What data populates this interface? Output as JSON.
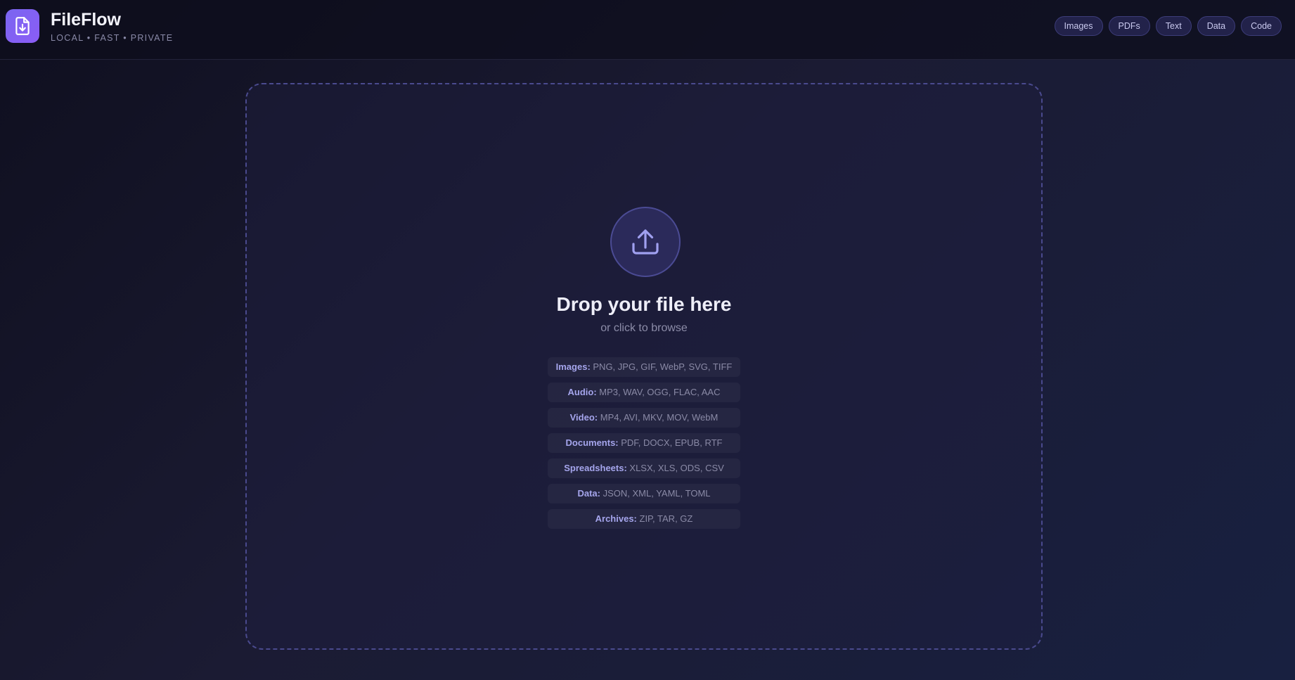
{
  "header": {
    "logo_icon": "file-download-icon",
    "title": "FileFlow",
    "tagline": "LOCAL • FAST • PRIVATE",
    "nav": [
      {
        "label": "Images"
      },
      {
        "label": "PDFs"
      },
      {
        "label": "Text"
      },
      {
        "label": "Data"
      },
      {
        "label": "Code"
      }
    ]
  },
  "dropzone": {
    "icon": "upload-icon",
    "title": "Drop your file here",
    "subtitle": "or click to browse",
    "formats": [
      {
        "label": "Images:",
        "values": "PNG, JPG, GIF, WebP, SVG, TIFF"
      },
      {
        "label": "Audio:",
        "values": "MP3, WAV, OGG, FLAC, AAC"
      },
      {
        "label": "Video:",
        "values": "MP4, AVI, MKV, MOV, WebM"
      },
      {
        "label": "Documents:",
        "values": "PDF, DOCX, EPUB, RTF"
      },
      {
        "label": "Spreadsheets:",
        "values": "XLSX, XLS, ODS, CSV"
      },
      {
        "label": "Data:",
        "values": "JSON, XML, YAML, TOML"
      },
      {
        "label": "Archives:",
        "values": "ZIP, TAR, GZ"
      }
    ]
  },
  "colors": {
    "accent": "#8b5cf6",
    "background": "#141428",
    "format_label": "#a5a5ec",
    "nav_border": "#3d3d7a"
  }
}
